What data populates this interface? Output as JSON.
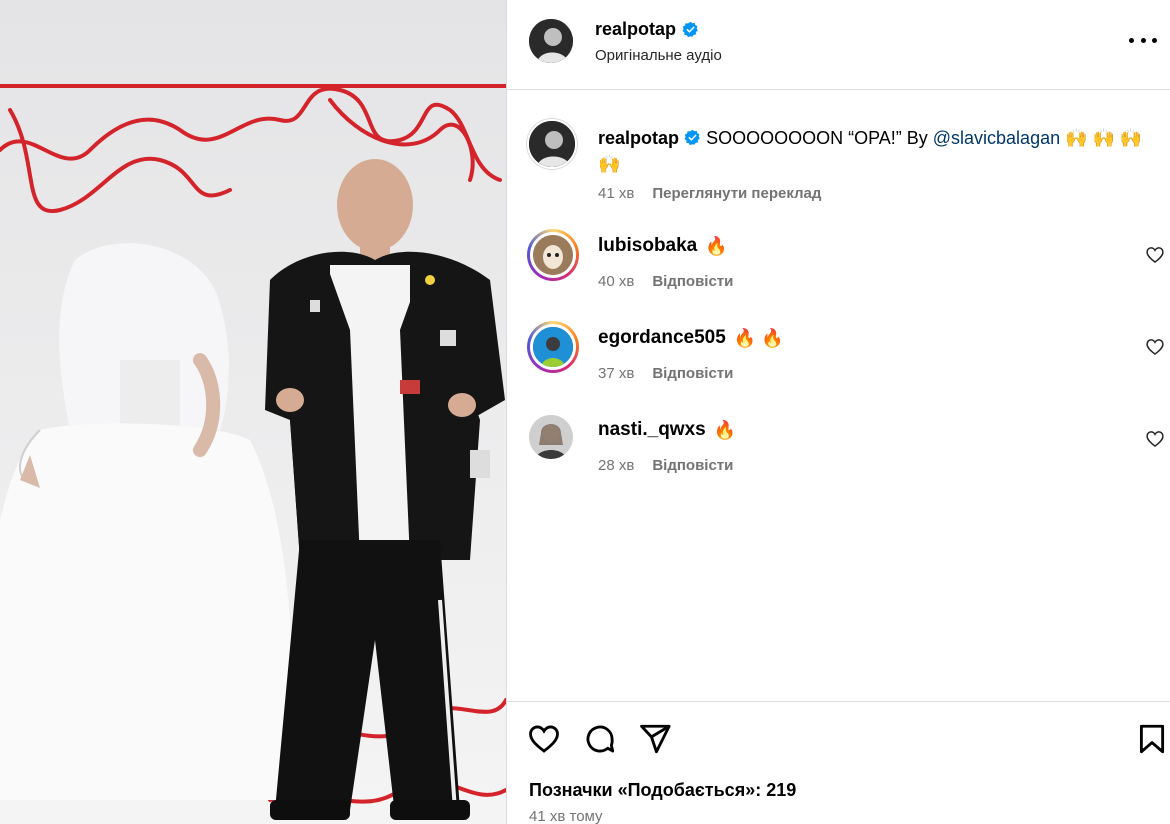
{
  "post": {
    "username": "realpotap",
    "audio_label": "Оригінальне аудіо",
    "verified": true,
    "more_icon": "more-horizontal-icon"
  },
  "caption": {
    "username": "realpotap",
    "text_before": "SOOOOOOOON “OPA!” By ",
    "mention": "@slavicbalagan",
    "text_after": " 🙌 🙌 🙌 🙌",
    "time": "41 хв",
    "translate_label": "Переглянути переклад"
  },
  "comments": [
    {
      "username": "lubisobaka",
      "text": "🔥",
      "time": "40 хв",
      "reply_label": "Відповісти"
    },
    {
      "username": "egordance505",
      "text": "🔥 🔥",
      "time": "37 хв",
      "reply_label": "Відповісти"
    },
    {
      "username": "nasti._qwxs",
      "text": "🔥",
      "time": "28 хв",
      "reply_label": "Відповісти"
    }
  ],
  "actions": {
    "like_icon": "heart-icon",
    "comment_icon": "comment-bubble-icon",
    "share_icon": "paper-plane-icon",
    "save_icon": "bookmark-icon",
    "likes_label": "Позначки «Подобається»: 219",
    "posted_ago": "41 хв тому"
  },
  "colors": {
    "accent_link": "#00376b",
    "muted": "#737373",
    "border": "#dbdbdb",
    "verified_blue": "#0095f6"
  }
}
